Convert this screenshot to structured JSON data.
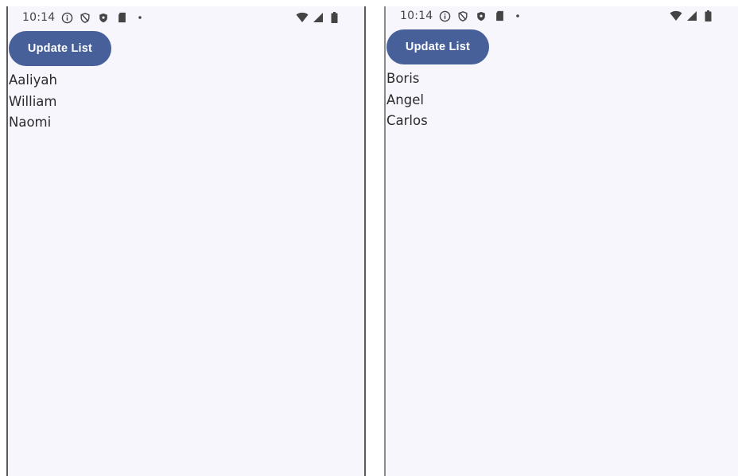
{
  "screens": [
    {
      "status_bar": {
        "time": "10:14"
      },
      "update_button_label": "Update List",
      "items": [
        "Aaliyah",
        "William",
        "Naomi"
      ]
    },
    {
      "status_bar": {
        "time": "10:14"
      },
      "update_button_label": "Update List",
      "items": [
        "Boris",
        "Angel",
        "Carlos"
      ]
    }
  ],
  "colors": {
    "button": "#47609a",
    "background": "#f8f6fd"
  }
}
